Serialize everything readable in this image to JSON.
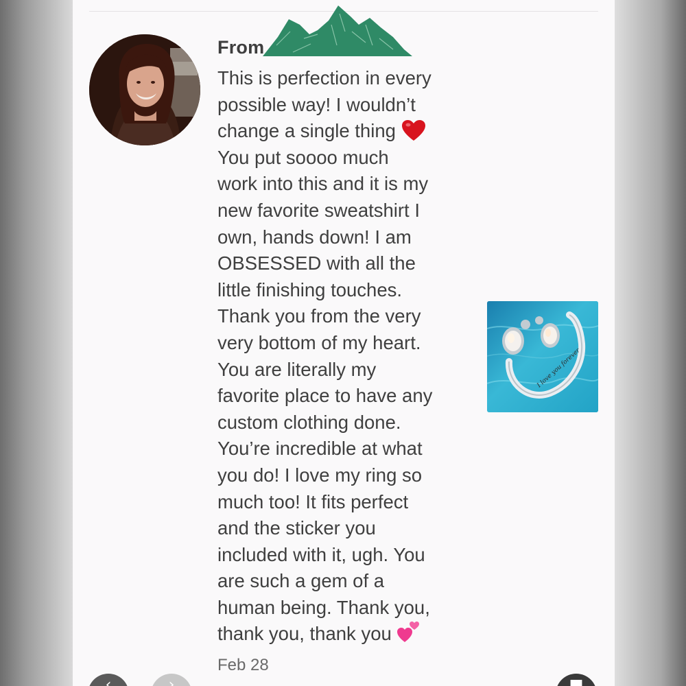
{
  "header": {
    "from_label": "From"
  },
  "message": {
    "lines": [
      "This is perfection in every",
      "possible way! I wouldn’t",
      "change a single thing",
      "You put soooo much",
      "work into this and it is my",
      "new favorite sweatshirt I",
      "own, hands down! I am",
      "OBSESSED with all the",
      "little finishing touches.",
      "Thank you from the very",
      "very bottom of my heart.",
      "You are literally my",
      "favorite place to have any",
      "custom clothing done.",
      "You’re incredible at what",
      "you do! I love my ring so",
      "much too! It fits perfect",
      "and the sticker you",
      "included with it, ugh. You",
      "are such a gem of a",
      "human being. Thank you,",
      "thank you, thank you"
    ],
    "emojis": {
      "line_3": "red-heart",
      "line_22": "two-hearts"
    },
    "date": "Feb 28"
  },
  "attachment": {
    "engraving": "I love you forever"
  },
  "colors": {
    "card_bg": "#faf9fa",
    "text": "#3f3f3f",
    "redaction_green": "#2f8a66",
    "heart_red": "#d8141e",
    "heart_pink": "#ef3a8f"
  },
  "nav": {
    "prev_icon": "chevron-left-icon",
    "next_icon": "chevron-right-icon",
    "action_icon": "square-icon"
  }
}
